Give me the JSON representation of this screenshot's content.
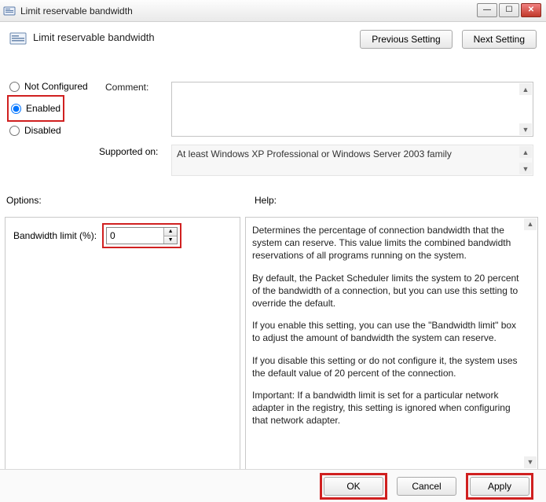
{
  "window": {
    "title": "Limit reservable bandwidth"
  },
  "header": {
    "policy_title": "Limit reservable bandwidth",
    "prev_btn": "Previous Setting",
    "next_btn": "Next Setting"
  },
  "state": {
    "not_configured": "Not Configured",
    "enabled": "Enabled",
    "disabled": "Disabled",
    "selected": "enabled"
  },
  "comment": {
    "label": "Comment:",
    "value": ""
  },
  "supported": {
    "label": "Supported on:",
    "value": "At least Windows XP Professional or Windows Server 2003 family"
  },
  "section_labels": {
    "options": "Options:",
    "help": "Help:"
  },
  "options": {
    "bandwidth_label": "Bandwidth limit (%):",
    "bandwidth_value": "0"
  },
  "help": {
    "p1": "Determines the percentage of connection bandwidth that the system can reserve. This value limits the combined bandwidth reservations of all programs running on the system.",
    "p2": "By default, the Packet Scheduler limits the system to 20 percent of the bandwidth of a connection, but you can use this setting to override the default.",
    "p3": "If you enable this setting, you can use the \"Bandwidth limit\" box to adjust the amount of bandwidth the system can reserve.",
    "p4": "If you disable this setting or do not configure it, the system uses the default value of 20 percent of the connection.",
    "p5": "Important: If a bandwidth limit is set for a particular network adapter in the registry, this setting is ignored when configuring that network adapter."
  },
  "footer": {
    "ok": "OK",
    "cancel": "Cancel",
    "apply": "Apply"
  }
}
